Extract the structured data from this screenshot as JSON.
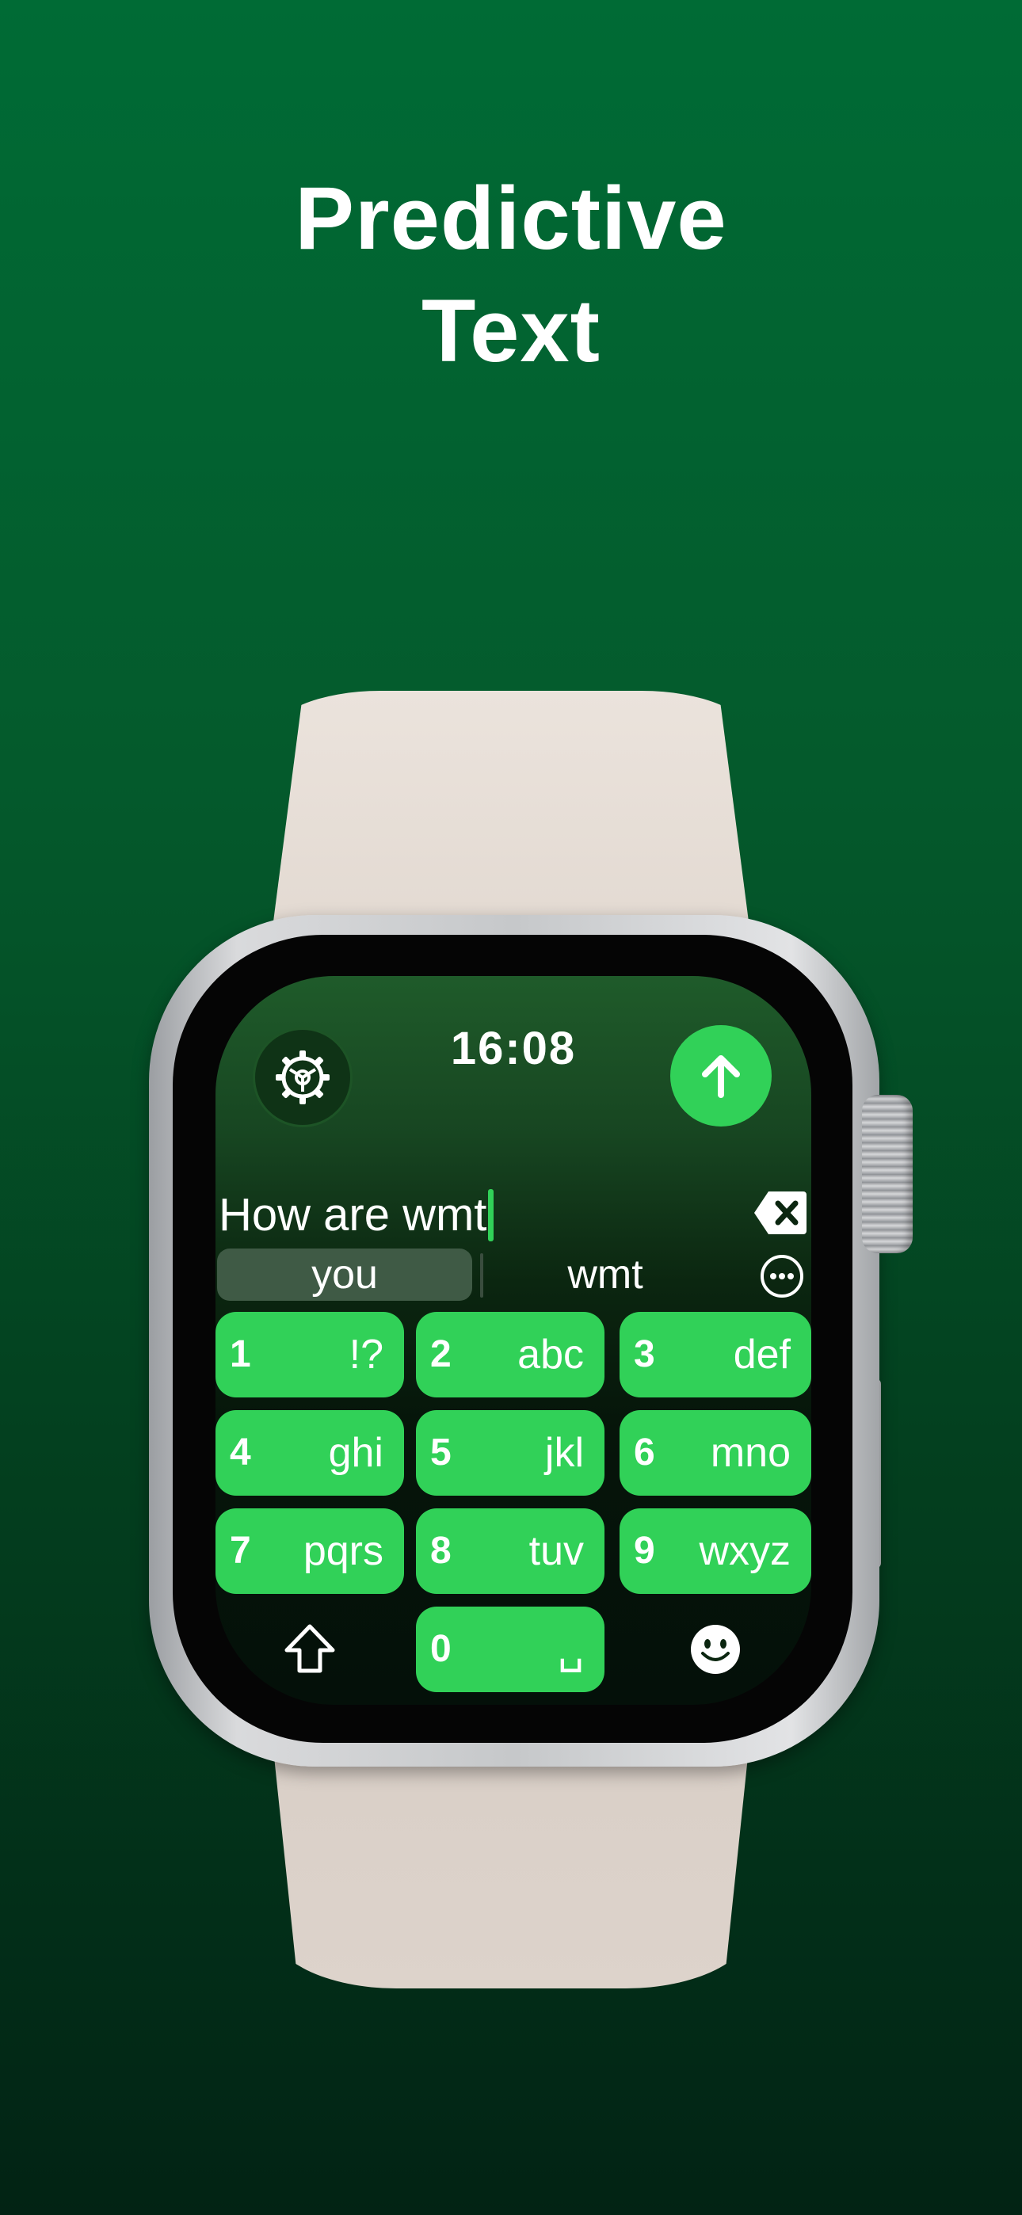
{
  "headline": {
    "line1": "Predictive",
    "line2": "Text"
  },
  "watch": {
    "time": "16:08",
    "input_text": "How are wmt",
    "suggestions": {
      "primary": "you",
      "secondary": "wmt"
    },
    "keys": [
      {
        "num": "1",
        "letters": "!?"
      },
      {
        "num": "2",
        "letters": "abc"
      },
      {
        "num": "3",
        "letters": "def"
      },
      {
        "num": "4",
        "letters": "ghi"
      },
      {
        "num": "5",
        "letters": "jkl"
      },
      {
        "num": "6",
        "letters": "mno"
      },
      {
        "num": "7",
        "letters": "pqrs"
      },
      {
        "num": "8",
        "letters": "tuv"
      },
      {
        "num": "9",
        "letters": "wxyz"
      },
      {
        "num": "0",
        "letters": "␣"
      }
    ],
    "icons": [
      "gear-icon",
      "arrow-up-icon",
      "delete-icon",
      "ellipsis-circle-icon",
      "shift-arrow-icon",
      "emoji-icon"
    ]
  },
  "colors": {
    "background_top": "#006b35",
    "background_bottom": "#022314",
    "key_green": "#31d158",
    "band": "#e5dcd4"
  }
}
